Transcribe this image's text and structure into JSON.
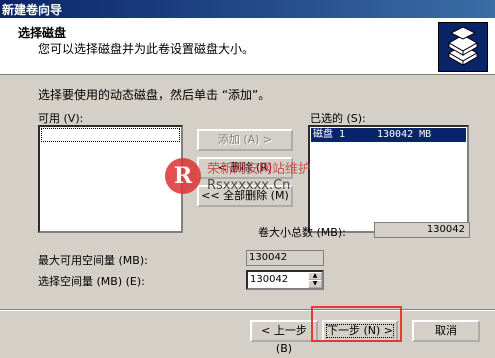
{
  "window": {
    "title": "新建卷向导"
  },
  "header": {
    "title": "选择磁盘",
    "subtitle": "您可以选择磁盘并为此卷设置磁盘大小。",
    "icon": "disk-stack-icon"
  },
  "instruction": "选择要使用的动态磁盘，然后单击 “添加”。",
  "available": {
    "label": "可用 (V):",
    "items": []
  },
  "selected": {
    "label": "已选的 (S):",
    "items": [
      {
        "name": "磁盘 1",
        "size": "130042 MB"
      }
    ]
  },
  "buttons": {
    "add": "添加 (A) >",
    "remove": "< 删除 (R)",
    "remove_all": "<< 全部删除 (M)",
    "back": "< 上一步 (B)",
    "next": "下一步 (N) >",
    "cancel": "取消"
  },
  "total": {
    "label": "卷大小总数 (MB):",
    "value": "130042"
  },
  "max_space": {
    "label": "最大可用空间量 (MB):",
    "value": "130042"
  },
  "select_space": {
    "label": "选择空间量 (MB) (E):",
    "value": "130042"
  },
  "watermark": {
    "line1": "荣新网安网站维护",
    "line2": "Rsxxxxxx.Cn"
  },
  "colors": {
    "highlight": "#e53935",
    "selection": "#0a246a"
  }
}
